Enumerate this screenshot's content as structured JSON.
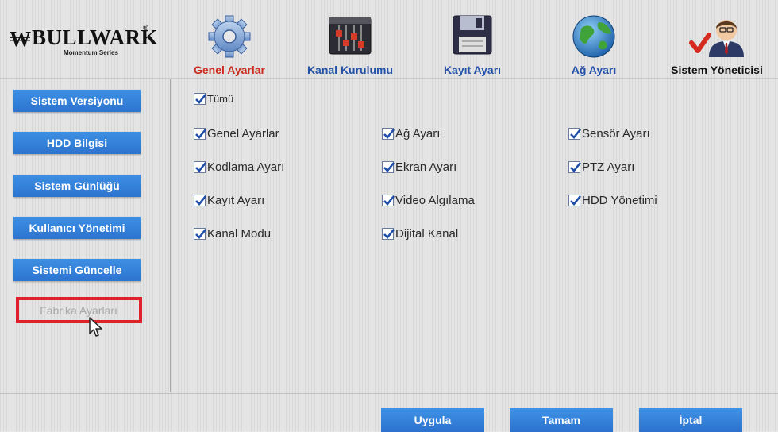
{
  "brand": {
    "name": "BULLWARK",
    "subtitle": "Momentum Series"
  },
  "tabs": [
    {
      "label": "Genel Ayarlar",
      "icon": "gear-icon",
      "active": true
    },
    {
      "label": "Kanal Kurulumu",
      "icon": "sliders-icon",
      "active": false
    },
    {
      "label": "Kayıt Ayarı",
      "icon": "floppy-disk-icon",
      "active": false
    },
    {
      "label": "Ağ Ayarı",
      "icon": "globe-icon",
      "active": false
    },
    {
      "label": "Sistem Yöneticisi",
      "icon": "admin-user-icon",
      "active": false
    }
  ],
  "sidebar": {
    "items": [
      {
        "label": "Sistem Versiyonu"
      },
      {
        "label": "HDD Bilgisi"
      },
      {
        "label": "Sistem Günlüğü"
      },
      {
        "label": "Kullanıcı Yönetimi"
      },
      {
        "label": "Sistemi Güncelle"
      },
      {
        "label": "Fabrika Ayarları"
      }
    ]
  },
  "checkboxes": {
    "all": {
      "label": "Tümü",
      "checked": true
    },
    "items": [
      {
        "label": "Genel Ayarlar",
        "checked": true
      },
      {
        "label": "Ağ Ayarı",
        "checked": true
      },
      {
        "label": "Sensör Ayarı",
        "checked": true
      },
      {
        "label": "Kodlama Ayarı",
        "checked": true
      },
      {
        "label": "Ekran Ayarı",
        "checked": true
      },
      {
        "label": "PTZ Ayarı",
        "checked": true
      },
      {
        "label": "Kayıt Ayarı",
        "checked": true
      },
      {
        "label": "Video Algılama",
        "checked": true
      },
      {
        "label": "HDD Yönetimi",
        "checked": true
      },
      {
        "label": "Kanal Modu",
        "checked": true
      },
      {
        "label": "Dijital Kanal",
        "checked": true
      }
    ]
  },
  "footer": {
    "apply_label": "Uygula",
    "ok_label": "Tamam",
    "cancel_label": "İptal"
  },
  "colors": {
    "accent_blue": "#2d74cf",
    "active_tab": "#cc2a1c",
    "highlight_red": "#e0202a",
    "check_blue": "#1f4fa8"
  }
}
